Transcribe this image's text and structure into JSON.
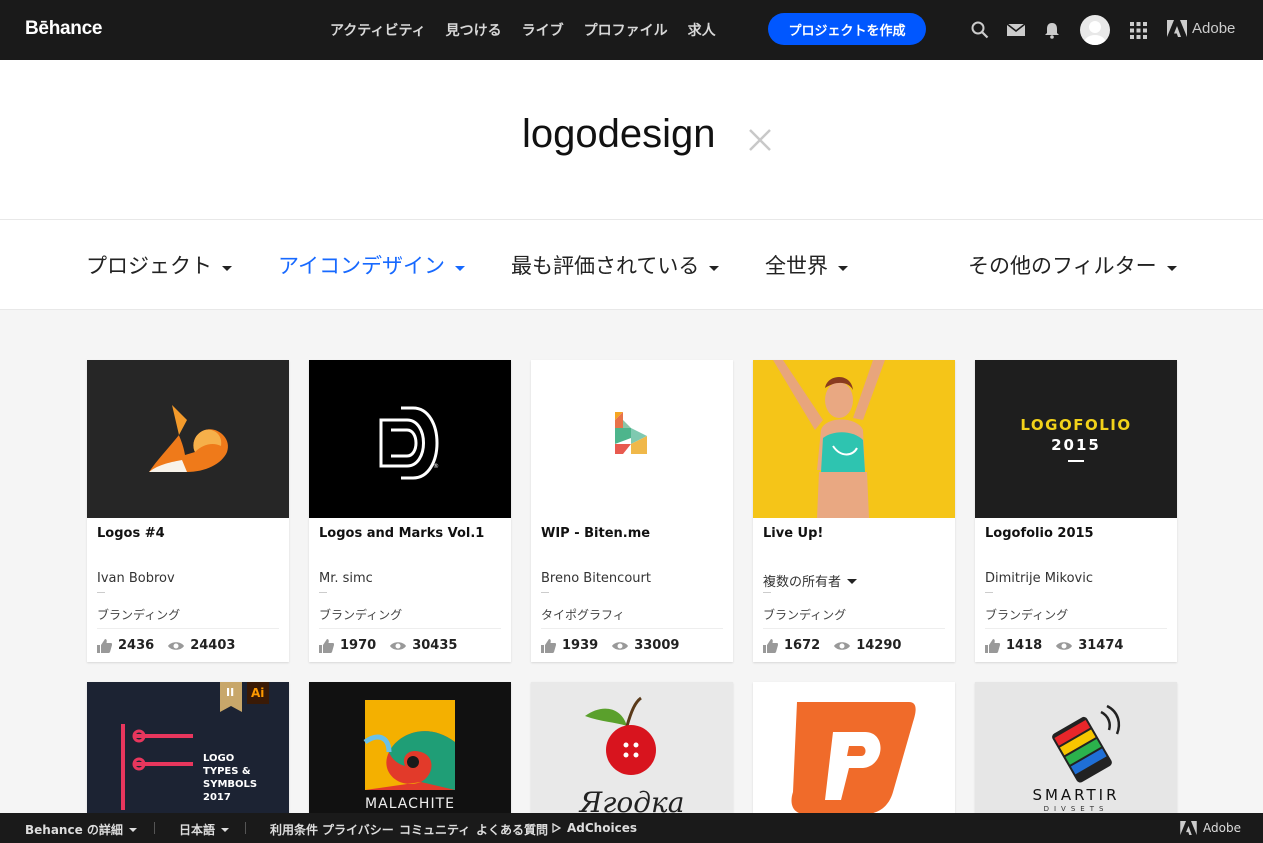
{
  "nav": {
    "logo": "Bēhance",
    "links": [
      "アクティビティ",
      "見つける",
      "ライブ",
      "プロファイル",
      "求人"
    ],
    "create_button": "プロジェクトを作成",
    "adobe": "Adobe",
    "icons": [
      "search-icon",
      "mail-icon",
      "bell-icon",
      "avatar",
      "apps-grid-icon",
      "adobe-logo-icon"
    ]
  },
  "search": {
    "term": "logodesign"
  },
  "filters": [
    {
      "label": "プロジェクト",
      "active": false
    },
    {
      "label": "アイコンデザイン",
      "active": true
    },
    {
      "label": "最も評価されている",
      "active": false
    },
    {
      "label": "全世界",
      "active": false
    },
    {
      "label": "その他のフィルター",
      "active": false
    }
  ],
  "cards": [
    {
      "title": "Logos #4",
      "owner": "Ivan Bobrov",
      "field": "ブランディング",
      "likes": "2436",
      "views": "24403",
      "owner_dropdown": false
    },
    {
      "title": "Logos and Marks Vol.1",
      "owner": "Mr. simc",
      "field": "ブランディング",
      "likes": "1970",
      "views": "30435",
      "owner_dropdown": false
    },
    {
      "title": "WIP - Biten.me",
      "owner": "Breno Bitencourt",
      "field": "タイポグラフィ",
      "likes": "1939",
      "views": "33009",
      "owner_dropdown": false
    },
    {
      "title": "Live Up!",
      "owner": "複数の所有者",
      "field": "ブランディング",
      "likes": "1672",
      "views": "14290",
      "owner_dropdown": true
    },
    {
      "title": "Logofolio 2015",
      "owner": "Dimitrije Mikovic",
      "field": "ブランディング",
      "likes": "1418",
      "views": "31474",
      "owner_dropdown": false
    }
  ],
  "thumb_text": {
    "logofolio_line1": "LOGOFOLIO",
    "logofolio_line2": "2015",
    "logo_types_line1": "LOGO",
    "logo_types_line2": "TYPES &",
    "logo_types_line3": "SYMBOLS",
    "logo_types_line4": "2017",
    "badge_ii": "II",
    "badge_ai": "Ai",
    "malachite": "MALACHITE",
    "yagodka": "Ягодка",
    "smartir": "SMARTIR",
    "smartir_sub": "DIVSETS"
  },
  "footer": {
    "about": "Behance の詳細",
    "language": "日本語",
    "links": [
      "利用条件",
      "プライバシー",
      "コミュニティ",
      "よくある質問"
    ],
    "adchoices": "AdChoices",
    "adobe": "Adobe"
  },
  "colors": {
    "accent": "#0057ff",
    "active_filter": "#1769ff",
    "topbar": "#1a1a1a"
  }
}
